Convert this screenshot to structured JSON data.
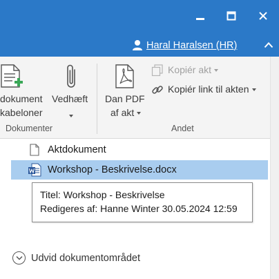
{
  "window": {
    "minimize_icon": "minimize-icon",
    "maximize_icon": "maximize-icon",
    "close_icon": "close-icon",
    "user_name": "Haral Haralsen (HR)",
    "collapse_icon": "chevron-up-icon"
  },
  "ribbon": {
    "groups": {
      "dokumenter": {
        "label": "Dokumenter",
        "dokument_skabeloner": {
          "line1": "dokument",
          "line2": "kabeloner"
        },
        "vedhaeft": {
          "line1": "Vedhæft"
        }
      },
      "andet": {
        "label": "Andet",
        "dan_pdf": {
          "line1": "Dan PDF",
          "line2": "af akt"
        },
        "kopier_akt": "Kopiér akt",
        "kopier_link": "Kopiér link til akten"
      }
    }
  },
  "files": [
    {
      "name": "Aktdokument",
      "icon": "document-icon",
      "selected": false
    },
    {
      "name": "Workshop - Beskrivelse.docx",
      "icon": "word-doc-icon",
      "selected": true
    }
  ],
  "tooltip": {
    "line1": "Titel: Workshop - Beskrivelse",
    "line2": "Redigeres af: Hanne Winter 30.05.2024 12:59"
  },
  "expand_area": {
    "label": "Udvid dokumentområdet"
  },
  "colors": {
    "titlebar": "#2b79c8",
    "selection": "#a9cdef",
    "ribbon_bg": "#f4f4f4"
  }
}
